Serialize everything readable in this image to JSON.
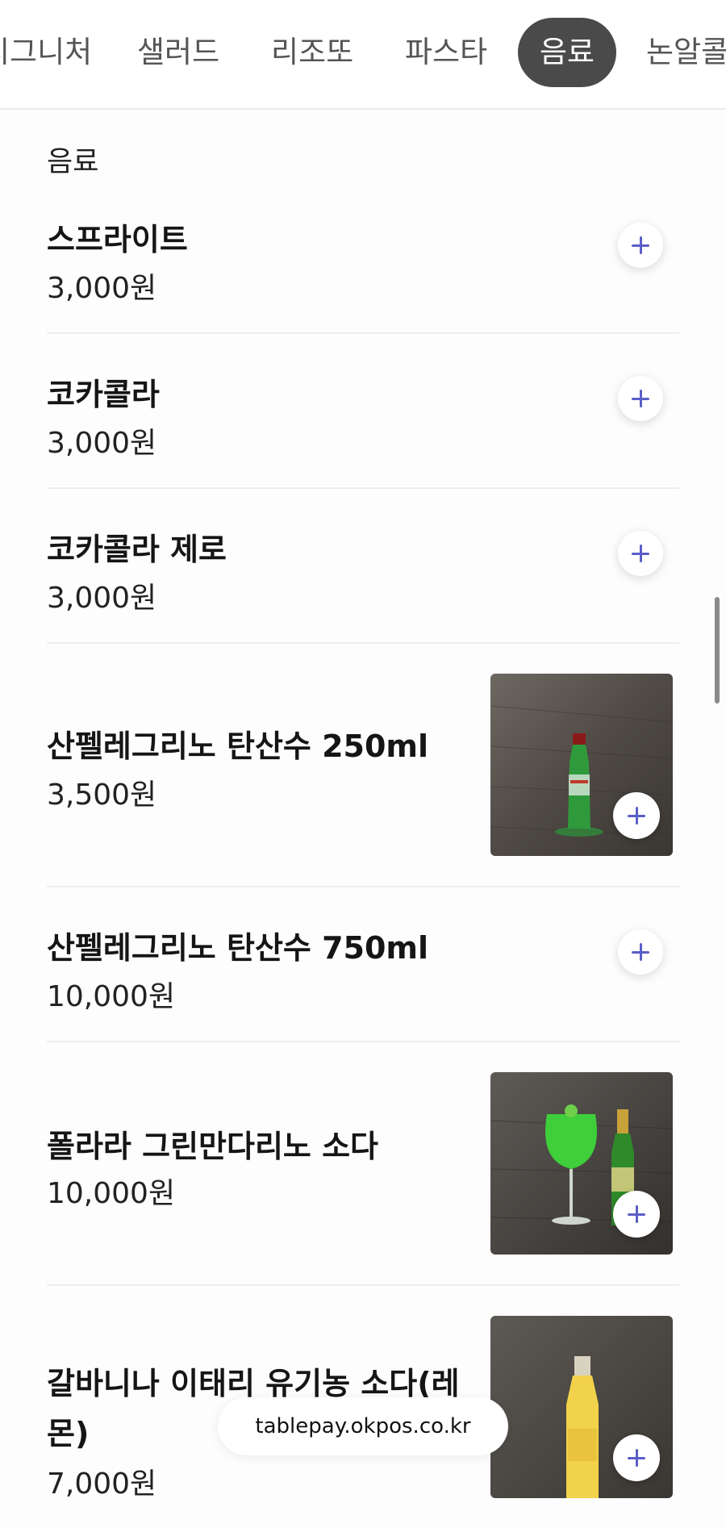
{
  "tabs": [
    {
      "label": "시그니처",
      "active": false
    },
    {
      "label": "샐러드",
      "active": false
    },
    {
      "label": "리조또",
      "active": false
    },
    {
      "label": "파스타",
      "active": false
    },
    {
      "label": "음료",
      "active": true
    },
    {
      "label": "논알콜",
      "active": false
    }
  ],
  "section": {
    "title": "음료"
  },
  "items": [
    {
      "name": "스프라이트",
      "price": "3,000원",
      "has_image": false
    },
    {
      "name": "코카콜라",
      "price": "3,000원",
      "has_image": false
    },
    {
      "name": "코카콜라 제로",
      "price": "3,000원",
      "has_image": false
    },
    {
      "name": "산펠레그리노 탄산수 250ml",
      "price": "3,500원",
      "has_image": true
    },
    {
      "name": "산펠레그리노 탄산수 750ml",
      "price": "10,000원",
      "has_image": false
    },
    {
      "name": "폴라라 그린만다리노 소다",
      "price": "10,000원",
      "has_image": true
    },
    {
      "name_line1": "갈바니나 이태리 유기농 소다(레",
      "name_line2": "몬)",
      "price": "7,000원",
      "has_image": true
    }
  ],
  "footer": {
    "url": "tablepay.okpos.co.kr"
  },
  "colors": {
    "accent": "#5a5ec8",
    "active_tab_bg": "#4a4a4a"
  }
}
